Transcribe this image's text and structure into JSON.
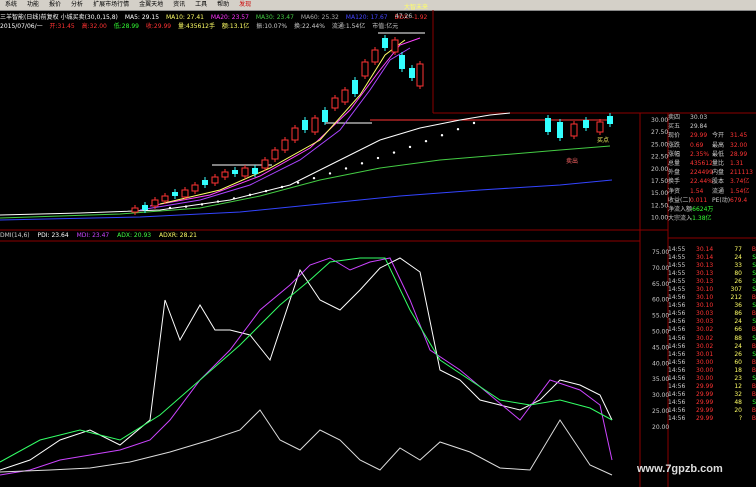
{
  "colors": {
    "up": "#ff3333",
    "down": "#33ffff",
    "ma_white": "#ffffff",
    "ma_green": "#44cc44",
    "ma_purple": "#6644cc",
    "ma_blue": "#3344ff",
    "pdi": "#ffffff",
    "mdi": "#cc44ff",
    "adx": "#33ff66",
    "grid": "#8b0000"
  },
  "menu": {
    "items": [
      "系统",
      "功能",
      "报价",
      "分析",
      "扩展市场行情",
      "金翼天地",
      "资讯",
      "工具",
      "帮助"
    ],
    "highlight": "发现"
  },
  "corner": "大智未来",
  "main_info": {
    "line1": [
      "三羊智能(日线)前复权 小城买卖(30,0,15,8)",
      "MA5: 29.15",
      "MA10: 27.41",
      "MA20: 23.57",
      "MA30: 23.47",
      "MA60: 25.32",
      "MA120: 17.67",
      "DDX: -1.92"
    ],
    "line2": [
      "2015/07/06/一",
      "开:31.45",
      "高:32.00",
      "低:28.99",
      "收:29.99",
      "量:435612手",
      "额:13.1亿",
      "振:10.07%",
      "换:22.44%",
      "流通:1.54亿",
      "市值:亿元"
    ]
  },
  "price_axis": [
    "30.00",
    "27.50",
    "25.00",
    "22.50",
    "20.00",
    "17.50",
    "15.00",
    "12.50",
    "10.00"
  ],
  "main_annotations": {
    "high": "47.26",
    "buy_label": "买点",
    "sell_label": "卖出"
  },
  "sub_info": [
    "DMI(14,6)",
    "PDI: 23.64",
    "MDI: 23.47",
    "ADX: 20.93",
    "ADXR: 28.21"
  ],
  "sub_axis": [
    "75.00",
    "70.00",
    "65.00",
    "60.00",
    "55.00",
    "50.00",
    "45.00",
    "40.00",
    "35.00",
    "30.00",
    "25.00",
    "20.00"
  ],
  "quote_panel": [
    {
      "k": "卖四",
      "v": "30.03",
      "k2": "",
      "v2": ""
    },
    {
      "k": "买五",
      "v": "29.84",
      "k2": "",
      "v2": ""
    },
    {
      "k": "现价",
      "v": "29.99",
      "k2": "今开",
      "v2": "31.45"
    },
    {
      "k": "涨跌",
      "v": "0.69",
      "k2": "最高",
      "v2": "32.00"
    },
    {
      "k": "涨幅",
      "v": "2.35%",
      "k2": "最低",
      "v2": "28.99"
    },
    {
      "k": "总量",
      "v": "435612",
      "k2": "量比",
      "v2": "1.31"
    },
    {
      "k": "外盘",
      "v": "224499",
      "k2": "内盘",
      "v2": "211113"
    },
    {
      "k": "换手",
      "v": "22.44%",
      "k2": "股本",
      "v2": "3.74亿"
    },
    {
      "k": "净资",
      "v": "1.54",
      "k2": "流通",
      "v2": "1.54亿"
    },
    {
      "k": "收益(二)",
      "v": "0.011",
      "k2": "PE(动)",
      "v2": "679.4"
    },
    {
      "k": "净流入额",
      "v": "-6624万",
      "k2": "",
      "v2": ""
    },
    {
      "k": "大宗流入",
      "v": "-1.38亿",
      "k2": "",
      "v2": ""
    }
  ],
  "ticks": [
    {
      "t": "14:55",
      "p": "30.14",
      "v": "77",
      "d": "B"
    },
    {
      "t": "14:55",
      "p": "30.14",
      "v": "24",
      "d": "S"
    },
    {
      "t": "14:55",
      "p": "30.13",
      "v": "33",
      "d": "S"
    },
    {
      "t": "14:55",
      "p": "30.13",
      "v": "80",
      "d": "S"
    },
    {
      "t": "14:55",
      "p": "30.13",
      "v": "26",
      "d": "S"
    },
    {
      "t": "14:55",
      "p": "30.10",
      "v": "307",
      "d": "S"
    },
    {
      "t": "14:56",
      "p": "30.10",
      "v": "212",
      "d": "B"
    },
    {
      "t": "14:56",
      "p": "30.10",
      "v": "36",
      "d": "S"
    },
    {
      "t": "14:56",
      "p": "30.03",
      "v": "86",
      "d": "B"
    },
    {
      "t": "14:56",
      "p": "30.03",
      "v": "24",
      "d": "S"
    },
    {
      "t": "14:56",
      "p": "30.02",
      "v": "66",
      "d": "B"
    },
    {
      "t": "14:56",
      "p": "30.02",
      "v": "88",
      "d": "S"
    },
    {
      "t": "14:56",
      "p": "30.02",
      "v": "24",
      "d": "B"
    },
    {
      "t": "14:56",
      "p": "30.01",
      "v": "26",
      "d": "S"
    },
    {
      "t": "14:56",
      "p": "30.00",
      "v": "60",
      "d": "B"
    },
    {
      "t": "14:56",
      "p": "30.00",
      "v": "18",
      "d": "B"
    },
    {
      "t": "14:56",
      "p": "30.00",
      "v": "23",
      "d": "S"
    },
    {
      "t": "14:56",
      "p": "29.99",
      "v": "12",
      "d": "B"
    },
    {
      "t": "14:56",
      "p": "29.99",
      "v": "32",
      "d": "B"
    },
    {
      "t": "14:56",
      "p": "29.99",
      "v": "48",
      "d": "S"
    },
    {
      "t": "14:56",
      "p": "29.99",
      "v": "20",
      "d": "B"
    },
    {
      "t": "14:56",
      "p": "29.99",
      "v": "?",
      "d": "B"
    }
  ],
  "watermark": "www.7gpzb.com"
}
